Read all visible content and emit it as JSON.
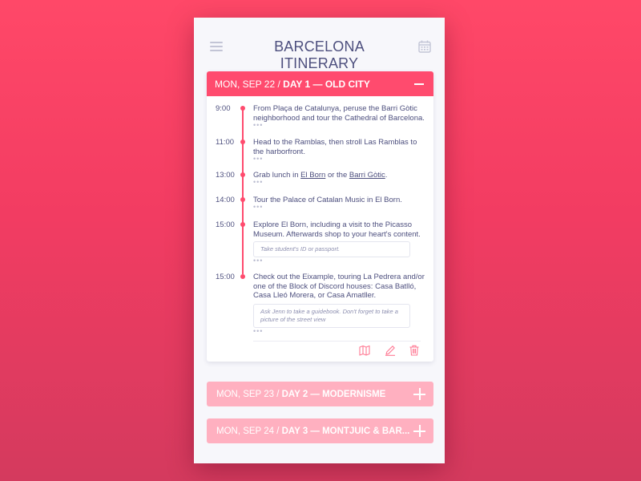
{
  "header": {
    "title": "BARCELONA ITINERARY",
    "menu_icon": "hamburger-menu-icon",
    "calendar_icon": "calendar-icon"
  },
  "colors": {
    "accent": "#ff4b6e",
    "text": "#4d4f7e",
    "collapsed_header": "#ffb0c0"
  },
  "days": [
    {
      "date": "MON, SEP 22",
      "sep": " / ",
      "title": "DAY 1 — OLD CITY",
      "expanded": true,
      "entries": [
        {
          "time": "9:00",
          "text": "From Plaça de Catalunya, peruse the Barri Gòtic neighborhood and tour the Cathedral of Barcelona.",
          "more": "•••"
        },
        {
          "time": "11:00",
          "text": "Head to the Ramblas, then stroll Las Ramblas to the harborfront.",
          "more": "•••"
        },
        {
          "time": "13:00",
          "text_before": "Grab lunch in ",
          "link1": "El Born",
          "text_mid": " or the ",
          "link2": "Barri Gòtic",
          "text_after": ".",
          "more": "•••"
        },
        {
          "time": "14:00",
          "text": "Tour the Palace of Catalan Music in El Born.",
          "more": "•••"
        },
        {
          "time": "15:00",
          "text": "Explore El Born, including a visit to the Picasso Museum. Afterwards shop to your heart's content.",
          "note": "Take student's ID or passport.",
          "more": "•••"
        },
        {
          "time": "15:00",
          "text": "Check out the Eixample, touring La Pedrera and/or one of the Block of Discord houses: Casa Batlló, Casa Lleó Morera, or Casa Amatller.",
          "note": "Ask Jenn to take a guidebook. Don't forget to take a picture of the street view",
          "more": "•••"
        }
      ],
      "actions": [
        "map-icon",
        "edit-icon",
        "trash-icon"
      ]
    },
    {
      "date": "MON, SEP 23",
      "sep": " / ",
      "title": "DAY 2 — MODERNISME",
      "expanded": false
    },
    {
      "date": "MON, SEP 24",
      "sep": " / ",
      "title": "DAY 3 — MONTJUIC & BAR...",
      "expanded": false
    }
  ]
}
